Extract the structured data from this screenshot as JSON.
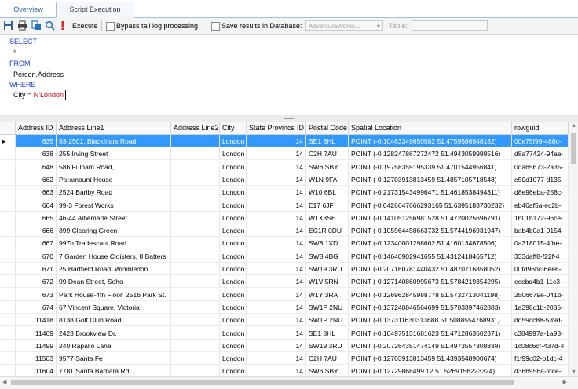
{
  "tabs": [
    {
      "label": "Overview"
    },
    {
      "label": "Script Execution"
    }
  ],
  "toolbar": {
    "execute_label": "Execute",
    "bypass_label": "Bypass tail log processing",
    "save_results_label": "Save results in Database:",
    "database_value": "AdventureWorks...",
    "table_label": "Table:"
  },
  "editor": {
    "lines": [
      {
        "text": "SELECT",
        "kind": "kw"
      },
      {
        "text": "  *",
        "kind": "text"
      },
      {
        "text": "",
        "kind": "text"
      },
      {
        "text": "FROM",
        "kind": "kw"
      },
      {
        "text": "  Person.Address",
        "kind": "text"
      },
      {
        "text": "WHERE",
        "kind": "kw"
      },
      {
        "text": "  City = N'London'",
        "kind": "text"
      }
    ]
  },
  "grid": {
    "columns": [
      "Address ID",
      "Address Line1",
      "Address Line2",
      "City",
      "State Province ID",
      "Postal Code",
      "Spatial Location",
      "rowguid"
    ],
    "rows": [
      [
        "635",
        "93-2501, Blackfriars Road,",
        "",
        "London",
        "14",
        "SE1 8HL",
        "POINT (-0.10463349650582 51.4759586948182)",
        "00e75f99-488c-"
      ],
      [
        "638",
        "255 Irving Street",
        "",
        "London",
        "14",
        "C2H 7AU",
        "POINT (-0.128247867272472 51.4943059998516)",
        "d8a77424-94ae-"
      ],
      [
        "648",
        "586 Fulham Road,",
        "",
        "London",
        "14",
        "SW6 SBY",
        "POINT (-0.19758359195339 51.4701544956841)",
        "0da65673-2a35-"
      ],
      [
        "662",
        "Paramount House",
        "",
        "London",
        "14",
        "W1N 9FA",
        "POINT (-0.12703913813459 51.4857105718548)",
        "e50d1077-d135-"
      ],
      [
        "663",
        "2524 Barlby Road",
        "",
        "London",
        "14",
        "W10 6BL",
        "POINT (-0.217315434996471 51.4618538494311)",
        "d8e96eba-258c-"
      ],
      [
        "664",
        "99-3 Forest Works",
        "",
        "London",
        "14",
        "E17 6JF",
        "POINT (-0.0426647666293165 51.6395183730232)",
        "eb46af5a-ec2b-"
      ],
      [
        "665",
        "46-44 Albemarle Street",
        "",
        "London",
        "14",
        "W1X3SE",
        "POINT (-0.141051256981528 51.4720025696791)",
        "1b01b172-96ce-"
      ],
      [
        "666",
        "399 Clearing Green",
        "",
        "London",
        "14",
        "EC1R 0DU",
        "POINT (-0.105964458663732 51.5744196931947)",
        "bab4b0a1-0154-"
      ],
      [
        "667",
        "997b Tradescant Road",
        "",
        "London",
        "14",
        "SW8 1XD",
        "POINT (-0.12340001298602 51.4160134678506)",
        "0a318015-4fbe-"
      ],
      [
        "670",
        "7 Garden House Cloisters, 8 Batters",
        "",
        "London",
        "14",
        "SW8 4BG",
        "POINT (-0.14640902941655 51.4312418465712)",
        "333daff8-f22f-4"
      ],
      [
        "671",
        "25 Hartfield Road, Wimbledon",
        "",
        "London",
        "14",
        "SW19 3RU",
        "POINT (-0.207160781440432 51.4870716858052)",
        "00fd96bc-6ee6-"
      ],
      [
        "672",
        "99 Dean Street, Soho",
        "",
        "London",
        "14",
        "W1V 5RN",
        "POINT (-0.127140860995673 51.5784219354295)",
        "ecebd4b1-11c3-"
      ],
      [
        "673",
        "Park House-4th Floor, 2516 Park St.",
        "",
        "London",
        "14",
        "W1Y 3RA",
        "POINT (-0.126962845988778 51.5732713041198)",
        "2506679e-041b-"
      ],
      [
        "674",
        "67 Vincent Square, Victoria",
        "",
        "London",
        "14",
        "SW1P 2NU",
        "POINT (-0.137240846564699 51.5703397462883)",
        "1a398c1b-2085-"
      ],
      [
        "11418",
        "8138 Golf Club Road",
        "",
        "London",
        "14",
        "SW1P 2NU",
        "POINT (-0.137311630313688 51.5088554768931)",
        "dd59cc88-539d-"
      ],
      [
        "11469",
        "2423 Brookview Dr.",
        "",
        "London",
        "14",
        "SE1 8HL",
        "POINT (-0.104975131681623 51.4712863502371)",
        "c384997a-1a93-"
      ],
      [
        "11499",
        "240 Rapallo Lane",
        "",
        "London",
        "14",
        "SW19 3RU",
        "POINT (-0.207264351474149 51.4973557308838)",
        "1c08c6cf-437d-4"
      ],
      [
        "11503",
        "9577 Santa Fe",
        "",
        "London",
        "14",
        "C2H 7AU",
        "POINT (-0.12703913813459 51.4393548900674)",
        "f1f99c02-b1dc-4"
      ],
      [
        "11604",
        "7781 Santa Barbara Rd",
        "",
        "London",
        "14",
        "SW6 SBY",
        "POINT (-0.12729868499 12 51.5269156223324)",
        "d36b956a-fdce-"
      ]
    ]
  },
  "colors": {
    "selection": "#3399ff",
    "keyword": "#1f3fd0",
    "string": "#c00000",
    "tab_accent": "#2d5f9a"
  },
  "icons": [
    "save-icon",
    "print-icon",
    "copy-icon",
    "find-icon",
    "execute-icon"
  ]
}
